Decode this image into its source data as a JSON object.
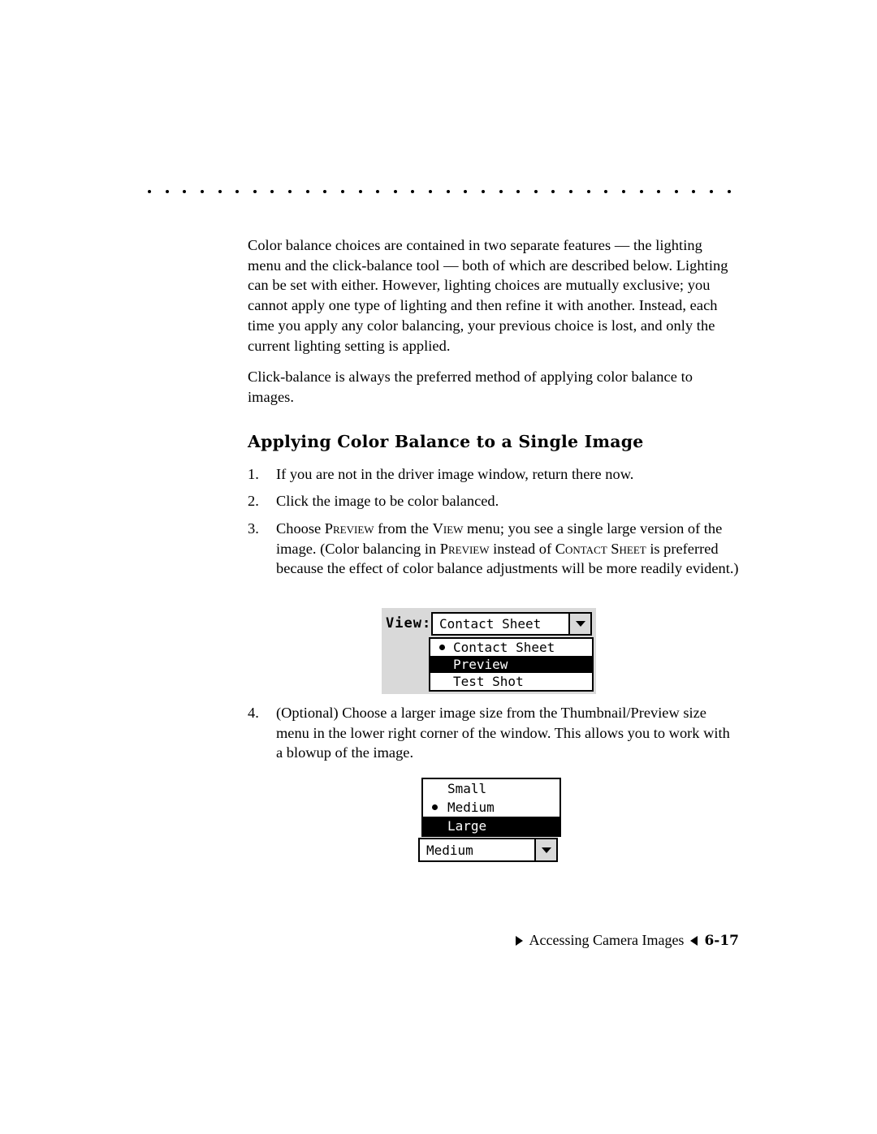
{
  "page": {
    "paragraphs": [
      "Color balance choices are contained in two separate features — the lighting menu and the click-balance tool — both of which are described below. Lighting can be set with either. However, lighting choices are mutually exclusive; you cannot apply one type of lighting and then refine it with another. Instead, each time you apply any color balancing, your previous choice is lost, and only the current lighting setting is applied.",
      "Click-balance is always the preferred method of applying color balance to images."
    ],
    "section_heading": "Applying Color Balance to a Single Image",
    "steps": [
      {
        "num": "1.",
        "text": "If you are not in the driver image window, return there now."
      },
      {
        "num": "2.",
        "text": "Click the image to be color balanced."
      },
      {
        "num": "3.",
        "text": "Choose PREVIEW from the VIEW menu; you see a single large version of the image. (Color balancing in PREVIEW instead of CONTACT SHEET is preferred because the effect of color balance adjustments will be more readily evident.)"
      },
      {
        "num": "4.",
        "text": "(Optional) Choose a larger image size from the Thumbnail/Preview size menu in the lower right corner of the window. This allows you to work with a blowup of the image."
      }
    ],
    "step3_parts": {
      "a": "Choose ",
      "sc1": "Preview",
      "b": " from the ",
      "sc2": "View",
      "c": " menu; you see a single large version of the image. (Color balancing in ",
      "sc3": "Preview",
      "d": " instead of ",
      "sc4": "Contact Sheet",
      "e": " is preferred because the effect of color balance adjustments will be more readily evident.)"
    }
  },
  "figure_view": {
    "label": "View:",
    "selected_value": "Contact Sheet",
    "dropdown_arrow": "chevron-down-icon",
    "options": [
      {
        "label": "Contact Sheet",
        "checked": true,
        "highlighted": false
      },
      {
        "label": "Preview",
        "checked": false,
        "highlighted": true
      },
      {
        "label": "Test Shot",
        "checked": false,
        "highlighted": false
      }
    ]
  },
  "figure_size": {
    "selected_value": "Medium",
    "dropdown_arrow": "chevron-down-icon",
    "options": [
      {
        "label": "Small",
        "checked": false,
        "highlighted": false
      },
      {
        "label": "Medium",
        "checked": true,
        "highlighted": false
      },
      {
        "label": "Large",
        "checked": false,
        "highlighted": true
      }
    ]
  },
  "footer": {
    "text": "Accessing Camera Images",
    "page_number": "6-17"
  }
}
